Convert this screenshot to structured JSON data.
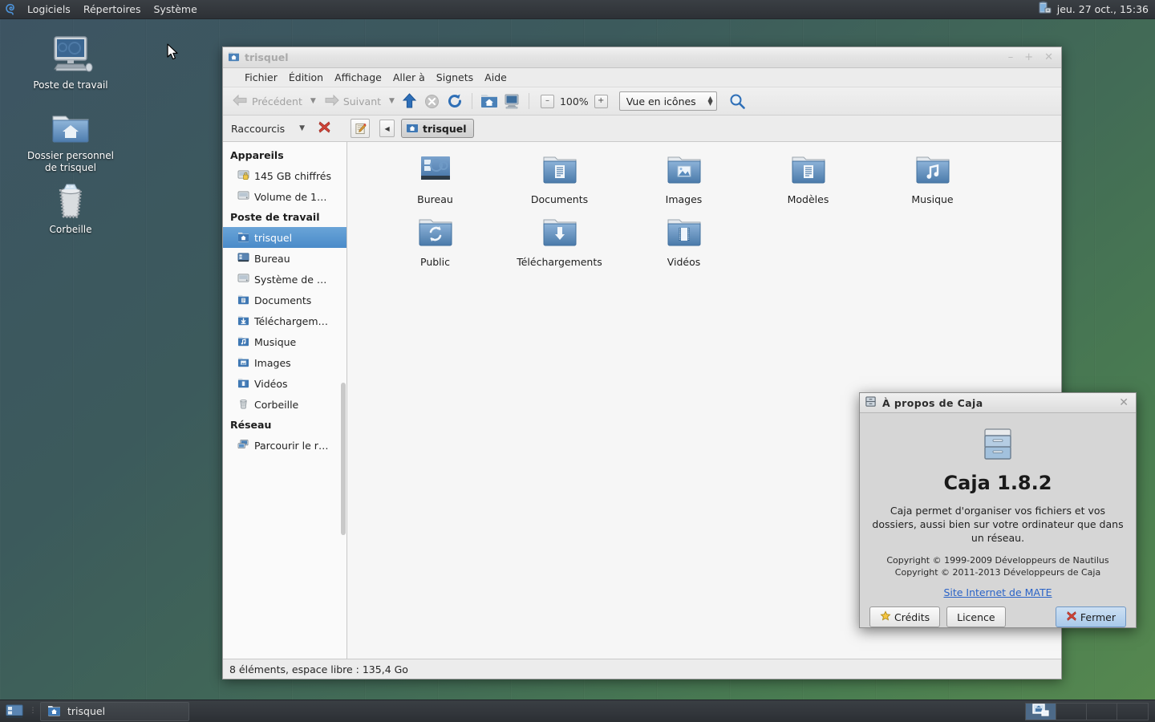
{
  "top_panel": {
    "logo_icon": "trisquel-logo-icon",
    "menus": [
      "Logiciels",
      "Répertoires",
      "Système"
    ],
    "tray_icon": "battery-icon",
    "clock": "jeu. 27 oct., 15:36"
  },
  "desktop": {
    "icons": [
      {
        "label": "Poste de travail",
        "icon": "computer-icon"
      },
      {
        "label": "Dossier personnel de trisquel",
        "icon": "home-folder-icon"
      },
      {
        "label": "Corbeille",
        "icon": "trash-icon"
      }
    ]
  },
  "file_manager": {
    "title": "trisquel",
    "window_icon": "home-folder-icon",
    "window_buttons": {
      "minimize": "–",
      "maximize": "+",
      "close": "✕"
    },
    "menubar": [
      "Fichier",
      "Édition",
      "Affichage",
      "Aller à",
      "Signets",
      "Aide"
    ],
    "toolbar": {
      "back_label": "Précédent",
      "forward_label": "Suivant",
      "up_icon": "arrow-up-icon",
      "stop_icon": "stop-icon",
      "reload_icon": "reload-icon",
      "home_icon": "home-icon",
      "computer_icon": "computer-icon",
      "zoom_out": "–",
      "zoom_level": "100%",
      "zoom_in": "+",
      "view_mode": "Vue en icônes",
      "search_icon": "search-icon"
    },
    "location_bar": {
      "places_label": "Raccourcis",
      "remove_icon": "remove-red-x-icon",
      "edit_icon": "edit-location-icon",
      "prev_icon": "crumb-prev-icon",
      "crumb": "trisquel",
      "crumb_icon": "home-folder-icon"
    },
    "sidebar": {
      "sections": [
        {
          "header": "Appareils",
          "items": [
            {
              "label": "145 GB chiffrés",
              "icon": "encrypted-drive-icon",
              "selected": false
            },
            {
              "label": "Volume de 1…",
              "icon": "drive-icon",
              "selected": false
            }
          ]
        },
        {
          "header": "Poste de travail",
          "items": [
            {
              "label": "trisquel",
              "icon": "home-folder-icon",
              "selected": true
            },
            {
              "label": "Bureau",
              "icon": "desktop-icon",
              "selected": false
            },
            {
              "label": "Système de …",
              "icon": "filesystem-icon",
              "selected": false
            },
            {
              "label": "Documents",
              "icon": "documents-folder-icon",
              "selected": false
            },
            {
              "label": "Téléchargem…",
              "icon": "downloads-folder-icon",
              "selected": false
            },
            {
              "label": "Musique",
              "icon": "music-folder-icon",
              "selected": false
            },
            {
              "label": "Images",
              "icon": "pictures-folder-icon",
              "selected": false
            },
            {
              "label": "Vidéos",
              "icon": "videos-folder-icon",
              "selected": false
            },
            {
              "label": "Corbeille",
              "icon": "trash-icon",
              "selected": false
            }
          ]
        },
        {
          "header": "Réseau",
          "items": [
            {
              "label": "Parcourir le r…",
              "icon": "network-icon",
              "selected": false
            }
          ]
        }
      ]
    },
    "files": [
      {
        "label": "Bureau",
        "icon": "desktop-folder-icon"
      },
      {
        "label": "Documents",
        "icon": "documents-folder-icon"
      },
      {
        "label": "Images",
        "icon": "pictures-folder-icon"
      },
      {
        "label": "Modèles",
        "icon": "templates-folder-icon"
      },
      {
        "label": "Musique",
        "icon": "music-folder-icon"
      },
      {
        "label": "Public",
        "icon": "public-folder-icon"
      },
      {
        "label": "Téléchargements",
        "icon": "downloads-folder-icon"
      },
      {
        "label": "Vidéos",
        "icon": "videos-folder-icon"
      }
    ],
    "status": "8 éléments, espace libre : 135,4 Go"
  },
  "about_dialog": {
    "title": "À propos de Caja",
    "title_icon": "caja-cabinet-icon",
    "close_icon": "close-icon",
    "app_icon": "caja-cabinet-icon",
    "version": "Caja 1.8.2",
    "description": "Caja permet d'organiser vos fichiers et vos dossiers, aussi bien sur votre ordinateur que dans un réseau.",
    "copyright_line1": "Copyright © 1999-2009 Développeurs de Nautilus",
    "copyright_line2": "Copyright © 2011-2013 Développeurs de Caja",
    "link": "Site Internet de MATE",
    "buttons": {
      "credits": "Crédits",
      "credits_icon": "star-icon",
      "license": "Licence",
      "close": "Fermer",
      "close_button_icon": "red-x-icon"
    }
  },
  "bottom_panel": {
    "show_desktop_icon": "show-desktop-icon",
    "tasks": [
      {
        "label": "trisquel",
        "icon": "home-folder-icon"
      }
    ],
    "workspaces": [
      {
        "active": true,
        "icon": "workspace-window-icon"
      },
      {
        "active": false
      },
      {
        "active": false
      },
      {
        "active": false
      }
    ]
  },
  "colors": {
    "selection_blue": "#4a8bc9",
    "link_blue": "#2a63c7",
    "panel_dark": "#34383d",
    "folder_blue": "#6e99c6"
  }
}
